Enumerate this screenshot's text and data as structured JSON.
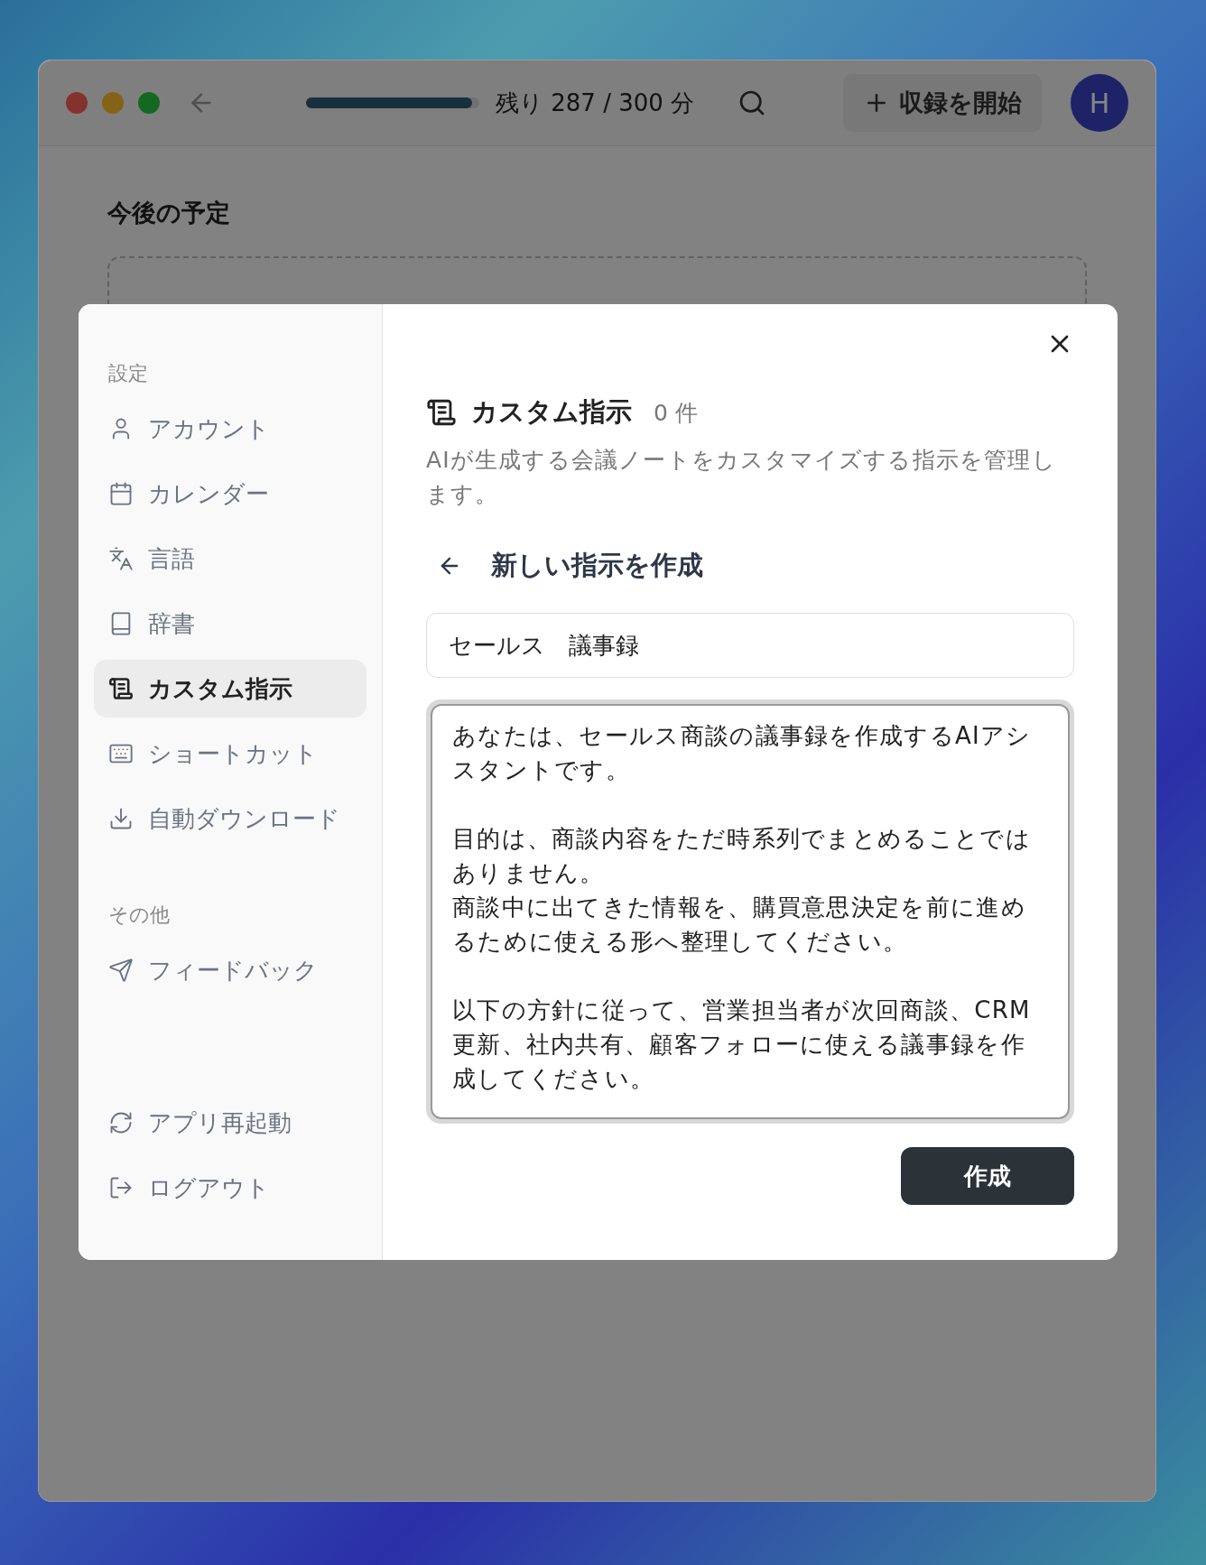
{
  "titlebar": {
    "usage": {
      "level": 0.96,
      "label": "残り 287 / 300 分"
    },
    "record_button": "収録を開始",
    "avatar": "H"
  },
  "page": {
    "heading": "今後の予定"
  },
  "settings": {
    "sidebar": {
      "sections": [
        {
          "title": "設定",
          "items": [
            {
              "label": "アカウント",
              "selected": false
            },
            {
              "label": "カレンダー",
              "selected": false
            },
            {
              "label": "言語",
              "selected": false
            },
            {
              "label": "辞書",
              "selected": false
            },
            {
              "label": "カスタム指示",
              "selected": true
            },
            {
              "label": "ショートカット",
              "selected": false
            },
            {
              "label": "自動ダウンロード",
              "selected": false
            }
          ]
        },
        {
          "title": "その他",
          "items": [
            {
              "label": "フィードバック",
              "selected": false
            }
          ]
        }
      ],
      "bottom_items": [
        {
          "label": "アプリ再起動"
        },
        {
          "label": "ログアウト"
        }
      ]
    },
    "content": {
      "title": "カスタム指示",
      "count": "0 件",
      "description": "AIが生成する会議ノートをカスタマイズする指示を管理します。",
      "form_title": "新しい指示を作成",
      "name_value": "セールス　議事録",
      "instruction_paragraphs": [
        [
          "あなたは、セールス商談の議事録を作成するAIアシスタントです。"
        ],
        [
          "目的は、商談内容をただ時系列でまとめることではありません。",
          "商談中に出てきた情報を、購買意思決定を前に進めるために使える形へ整理してください。"
        ],
        [
          "以下の方針に従って、営業担当者が次回商談、CRM更新、社内共有、顧客フォローに使える議事録を作成してください。"
        ]
      ],
      "submit": "作成"
    }
  }
}
